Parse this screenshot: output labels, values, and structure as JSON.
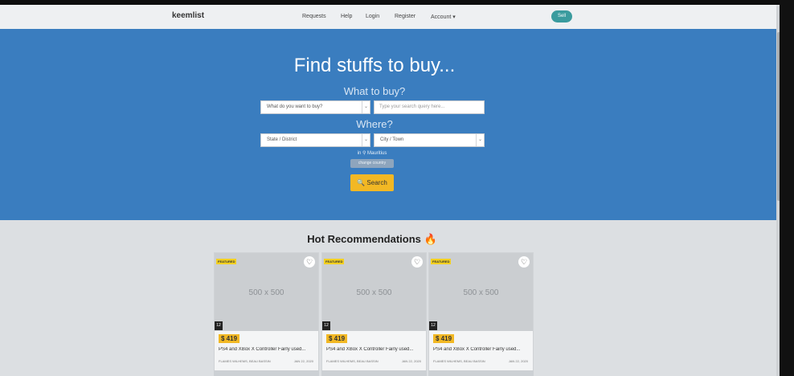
{
  "nav": {
    "brand": "keemlist",
    "links": [
      "Requests",
      "Help",
      "Login",
      "Register",
      "Account ▾"
    ],
    "sell": "Sell"
  },
  "hero": {
    "title": "Find stuffs to buy...",
    "what_label": "What to buy?",
    "what_select": "What do you want to buy?",
    "search_placeholder": "Type your search query here...",
    "where_label": "Where?",
    "state_select": "State / District",
    "city_select": "City / Town",
    "location": "in ⚲ Mauritius",
    "change_country": "change country",
    "search_button": "🔍 Search"
  },
  "recommendations": {
    "title": "Hot Recommendations",
    "flame": "🔥",
    "cards": [
      {
        "featured": "FEATURED",
        "image": "500 x 500",
        "count": "12",
        "price": "$ 419",
        "title": "PS4 and XBox X Controller Fairly used...",
        "location": "FLAMES WILHEMS, BEAU BASSIN",
        "date": "JAN 22, 2020"
      },
      {
        "featured": "FEATURED",
        "image": "500 x 500",
        "count": "12",
        "price": "$ 419",
        "title": "PS4 and XBox X Controller Fairly used...",
        "location": "FLAMES WILHEMS, BEAU BASSIN",
        "date": "JAN 22, 2020"
      },
      {
        "featured": "FEATURED",
        "image": "500 x 500",
        "count": "12",
        "price": "$ 419",
        "title": "PS4 and XBox X Controller Fairly used...",
        "location": "FLAMES WILHEMS, BEAU BASSIN",
        "date": "JAN 22, 2020"
      }
    ]
  },
  "colors": {
    "hero_bg": "#3a7dbf",
    "accent": "#f2b824",
    "sell": "#3a9b9e"
  }
}
